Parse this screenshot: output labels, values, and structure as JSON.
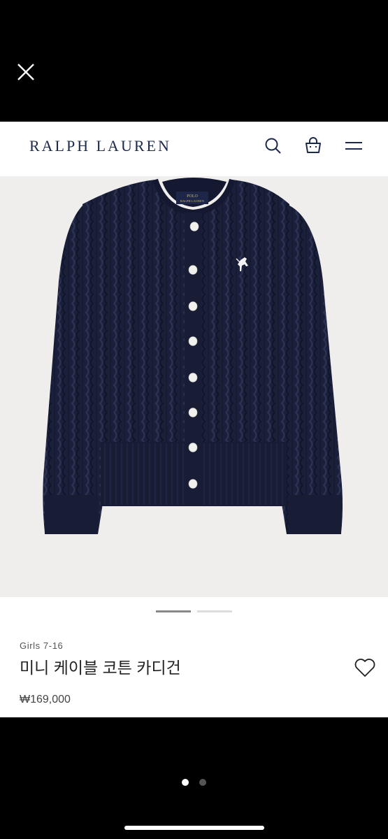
{
  "header": {
    "brand": "RALPH LAUREN",
    "icons": [
      "search-icon",
      "shopping-bag-icon",
      "menu-icon"
    ]
  },
  "overlay": {
    "close_icon": "close-icon"
  },
  "product": {
    "image": {
      "description_icon": "cable-knit-cardigan-image",
      "garment_color": "#1a1f3a",
      "tag_line1": "POLO",
      "tag_line2": "RALPH LAUREN"
    },
    "carousel": {
      "active_index": 0,
      "count": 2
    },
    "category": "Girls 7-16",
    "name": "미니 케이블 코튼 카디건",
    "price": "₩169,000",
    "wishlist_icon": "heart-outline-icon"
  },
  "viewer": {
    "pages": 2,
    "current_page": 1
  },
  "colors": {
    "brand": "#1b2a4a",
    "backdrop": "#000000",
    "image_bg": "#efeeec"
  }
}
